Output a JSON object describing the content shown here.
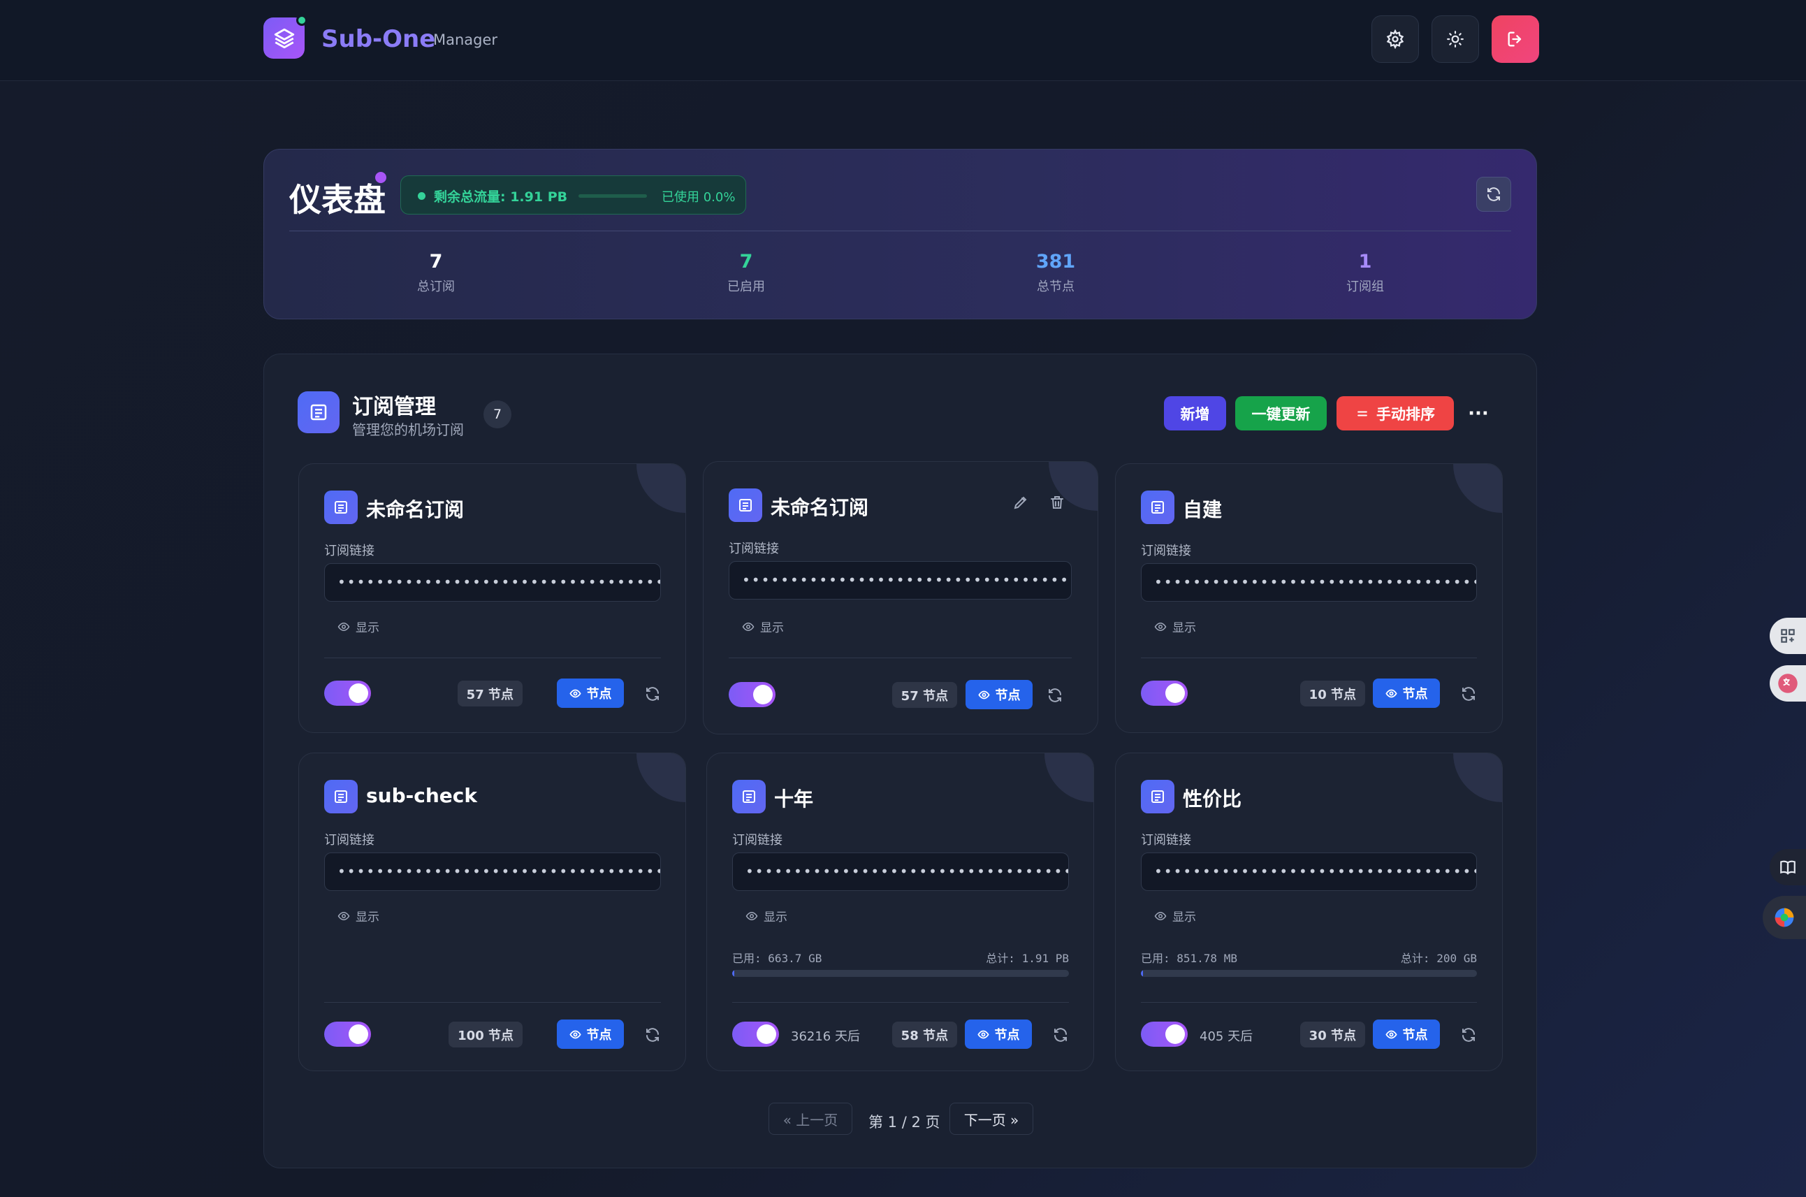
{
  "header": {
    "brand": "Sub-One",
    "brand_sub": "Manager",
    "icons": [
      "layers-icon",
      "settings-icon",
      "theme-sun-icon",
      "logout-icon"
    ]
  },
  "dashboard": {
    "title": "仪表盘",
    "traffic_label": "剩余总流量: 1.91 PB",
    "traffic_used": "已使用 0.0%",
    "traffic_used_fraction": 0.0,
    "stats": [
      {
        "value": "7",
        "label": "总订阅",
        "color": "#ffffff"
      },
      {
        "value": "7",
        "label": "已启用",
        "color": "#34d399"
      },
      {
        "value": "381",
        "label": "总节点",
        "color": "#60a5fa"
      },
      {
        "value": "1",
        "label": "订阅组",
        "color": "#a78bfa"
      }
    ]
  },
  "panel": {
    "title": "订阅管理",
    "subtitle": "管理您的机场订阅",
    "count": "7",
    "buttons": {
      "add": "新增",
      "update_all": "一键更新",
      "manual_sort": "手动排序",
      "more": "···"
    }
  },
  "common": {
    "link_label": "订阅链接",
    "show_label": "显示",
    "node_button": "节点",
    "url_mask": "•••••••••••••••••••••••••••••••••••••••••••"
  },
  "cards": [
    {
      "title": "未命名订阅",
      "nodes": "57 节点",
      "enabled": true,
      "editable": false
    },
    {
      "title": "未命名订阅",
      "nodes": "57 节点",
      "enabled": true,
      "editable": true
    },
    {
      "title": "自建",
      "nodes": "10 节点",
      "enabled": true,
      "editable": false
    },
    {
      "title": "sub-check",
      "nodes": "100 节点",
      "enabled": true,
      "editable": false
    },
    {
      "title": "十年",
      "nodes": "58 节点",
      "enabled": true,
      "editable": false,
      "used": "已用: 663.7 GB",
      "total": "总计: 1.91 PB",
      "usage_fraction": 0.0003,
      "expire": "36216 天后"
    },
    {
      "title": "性价比",
      "nodes": "30 节点",
      "enabled": true,
      "editable": false,
      "used": "已用: 851.78 MB",
      "total": "总计: 200 GB",
      "usage_fraction": 0.004,
      "expire": "405 天后"
    }
  ],
  "pagination": {
    "prev": "« 上一页",
    "info": "第 1 / 2 页",
    "next": "下一页 »"
  }
}
